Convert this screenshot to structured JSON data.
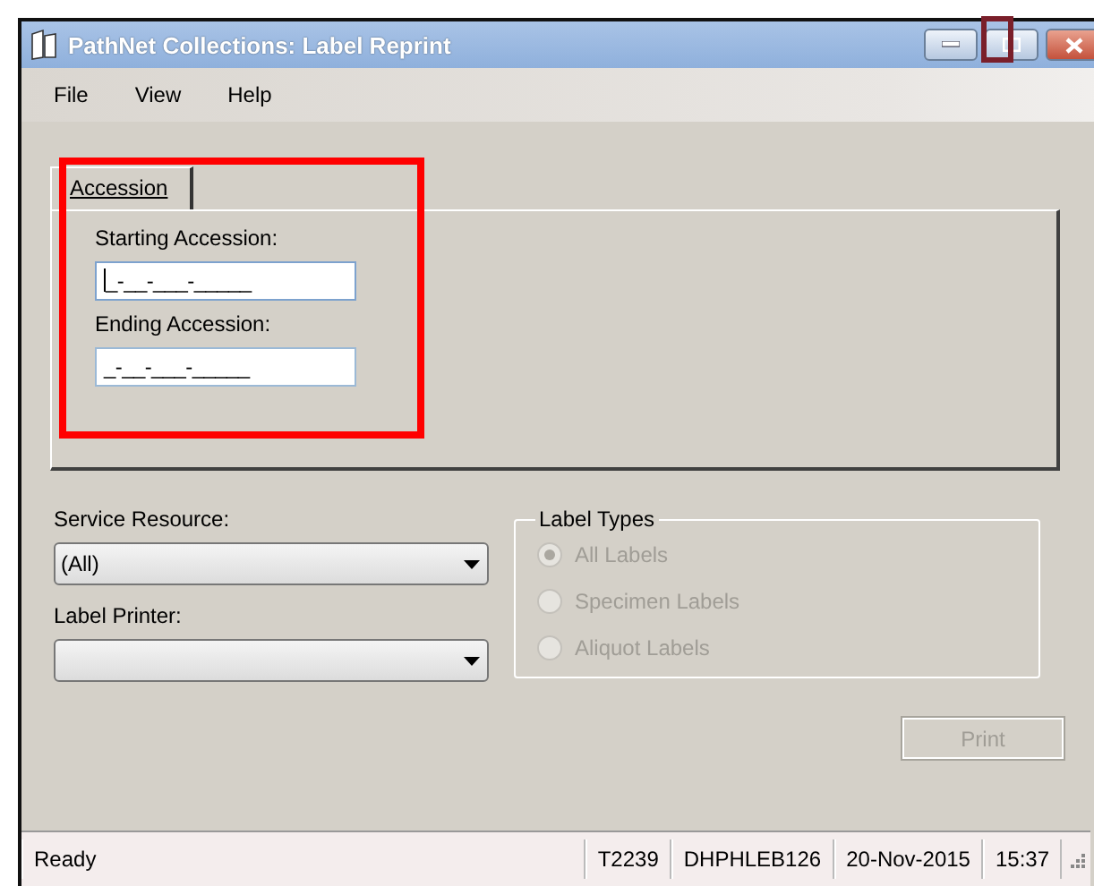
{
  "window": {
    "title": "PathNet Collections: Label Reprint"
  },
  "menu": [
    "File",
    "View",
    "Help"
  ],
  "tabs": [
    {
      "label": "Accession",
      "selected": true
    }
  ],
  "accession": {
    "fields": [
      {
        "label": "Starting Accession:",
        "value": "_-__-___-_____",
        "focused": true
      },
      {
        "label": "Ending Accession:",
        "value": "_-__-___-_____",
        "focused": false
      }
    ]
  },
  "service_resource": {
    "label": "Service Resource:",
    "value": "(All)"
  },
  "label_printer": {
    "label": "Label Printer:"
  },
  "label_types": {
    "title": "Label Types",
    "disabled": true,
    "options": [
      {
        "label": "All Labels",
        "selected": true
      },
      {
        "label": "Specimen Labels",
        "selected": false
      },
      {
        "label": "Aliquot Labels",
        "selected": false
      }
    ]
  },
  "print_button": {
    "label": "Print",
    "disabled": true
  },
  "status_bar": [
    "Ready",
    "T2239",
    "DHPHLEB126",
    "20-Nov-2015",
    "15:37"
  ]
}
